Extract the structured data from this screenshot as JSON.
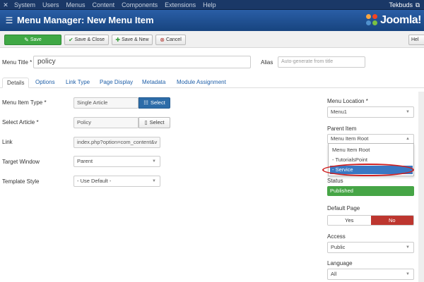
{
  "topbar": {
    "menu": [
      "System",
      "Users",
      "Menus",
      "Content",
      "Components",
      "Extensions",
      "Help"
    ],
    "user": "Tekbuds",
    "brand_icon": "joomla-x-icon",
    "user_icon": "external-link-icon"
  },
  "header": {
    "title": "Menu Manager: New Menu Item",
    "icon": "list-icon",
    "logo_text": "Joomla!"
  },
  "toolbar": {
    "save": "Save",
    "save_close": "Save & Close",
    "save_new": "Save & New",
    "cancel": "Cancel",
    "help": "Hel"
  },
  "form": {
    "menu_title_label": "Menu Title *",
    "menu_title_value": "policy",
    "alias_label": "Alias",
    "alias_placeholder": "Auto-generate from title"
  },
  "tabs": [
    "Details",
    "Options",
    "Link Type",
    "Page Display",
    "Metadata",
    "Module Assignment"
  ],
  "details": {
    "menu_item_type_label": "Menu Item Type *",
    "menu_item_type_value": "Single Article",
    "select_label": "Select",
    "select_article_label": "Select Article *",
    "select_article_value": "Policy",
    "link_label": "Link",
    "link_value": "index.php?option=com_content&v",
    "target_window_label": "Target Window",
    "target_window_value": "Parent",
    "template_style_label": "Template Style",
    "template_style_value": "- Use Default -"
  },
  "sidebar": {
    "menu_location_label": "Menu Location *",
    "menu_location_value": "Menu1",
    "parent_item_label": "Parent Item",
    "parent_item_value": "Menu Item Root",
    "parent_options": [
      "Menu Item Root",
      "- TutorialsPoint",
      "- Service"
    ],
    "status_label": "Status",
    "status_value": "Published",
    "default_page_label": "Default Page",
    "default_yes": "Yes",
    "default_no": "No",
    "access_label": "Access",
    "access_value": "Public",
    "language_label": "Language",
    "language_value": "All"
  },
  "colors": {
    "topbar": "#1a3867",
    "header": "#1d4f93",
    "save_green": "#3fa845",
    "status_green": "#46a546",
    "no_red": "#bd362f",
    "select_blue": "#2d6ca8",
    "highlight": "#3a78c3",
    "annotation": "#d02020"
  }
}
